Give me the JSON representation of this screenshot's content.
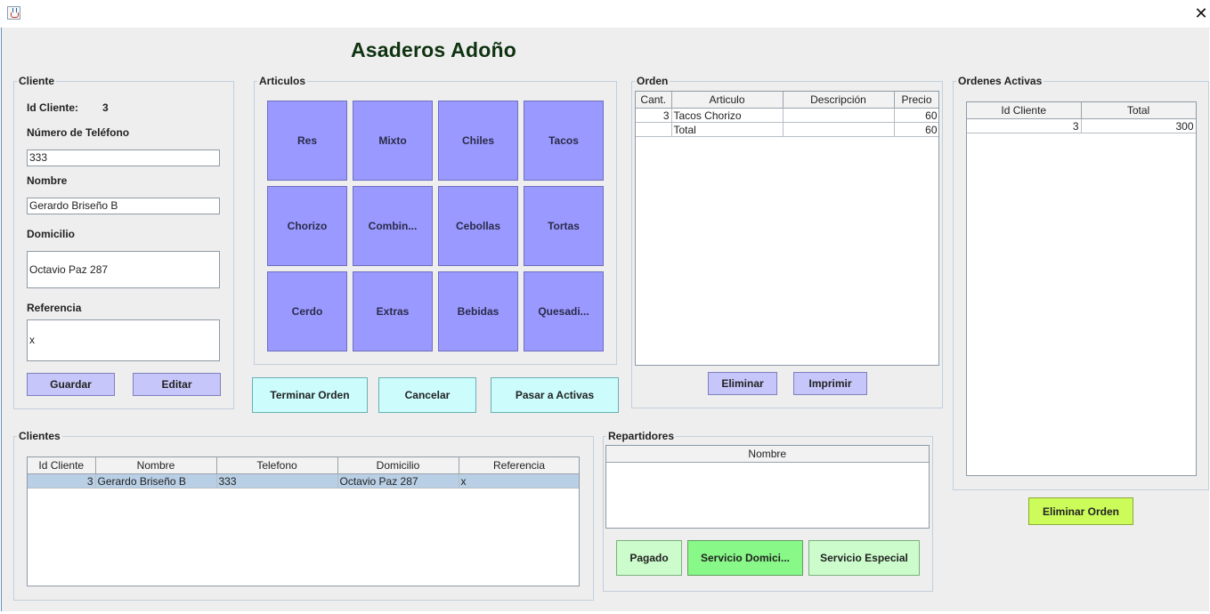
{
  "app_title": "Asaderos Adoño",
  "cliente": {
    "legend": "Cliente",
    "id_label": "Id Cliente:",
    "id_value": "3",
    "phone_label": "Número de Teléfono",
    "phone_value": "333",
    "name_label": "Nombre",
    "name_value": "Gerardo Briseño B",
    "address_label": "Domicilio",
    "address_value": "Octavio Paz 287",
    "reference_label": "Referencia",
    "reference_value": "x",
    "save_label": "Guardar",
    "edit_label": "Editar"
  },
  "articulos": {
    "legend": "Articulos",
    "items": [
      "Res",
      "Mixto",
      "Chiles",
      "Tacos",
      "Chorizo",
      "Combin...",
      "Cebollas",
      "Tortas",
      "Cerdo",
      "Extras",
      "Bebidas",
      "Quesadi..."
    ]
  },
  "actions": {
    "finish_label": "Terminar Orden",
    "cancel_label": "Cancelar",
    "activate_label": "Pasar a Activas"
  },
  "orden": {
    "legend": "Orden",
    "columns": [
      "Cant.",
      "Articulo",
      "Descripción",
      "Precio"
    ],
    "rows": [
      [
        "3",
        "Tacos Chorizo",
        "",
        "60"
      ],
      [
        "",
        "Total",
        "",
        "60"
      ]
    ],
    "delete_label": "Eliminar",
    "print_label": "Imprimir"
  },
  "activas": {
    "legend": "Ordenes Activas",
    "columns": [
      "Id Cliente",
      "Total"
    ],
    "rows": [
      [
        "3",
        "300"
      ]
    ],
    "delete_order_label": "Eliminar Orden"
  },
  "clientes": {
    "legend": "Clientes",
    "columns": [
      "Id Cliente",
      "Nombre",
      "Telefono",
      "Domicilio",
      "Referencia"
    ],
    "rows": [
      [
        "3",
        "Gerardo Briseño B",
        "333",
        "Octavio Paz 287",
        "x"
      ]
    ]
  },
  "repartidores": {
    "legend": "Repartidores",
    "columns": [
      "Nombre"
    ],
    "paid_label": "Pagado",
    "home_service_label": "Servicio Domici...",
    "special_service_label": "Servicio Especial"
  },
  "icons": {
    "app_icon": "java-cup-icon",
    "close_icon": "close-icon"
  },
  "colors": {
    "title": "#0f3310",
    "tile": "#9999ff",
    "button_lavender": "#c6c6fa",
    "button_cyan": "#ccfcfc",
    "button_mint": "#ccfccc",
    "button_green": "#88f888",
    "button_lime": "#ccfc5a",
    "selected_row": "#b8cfe5"
  }
}
